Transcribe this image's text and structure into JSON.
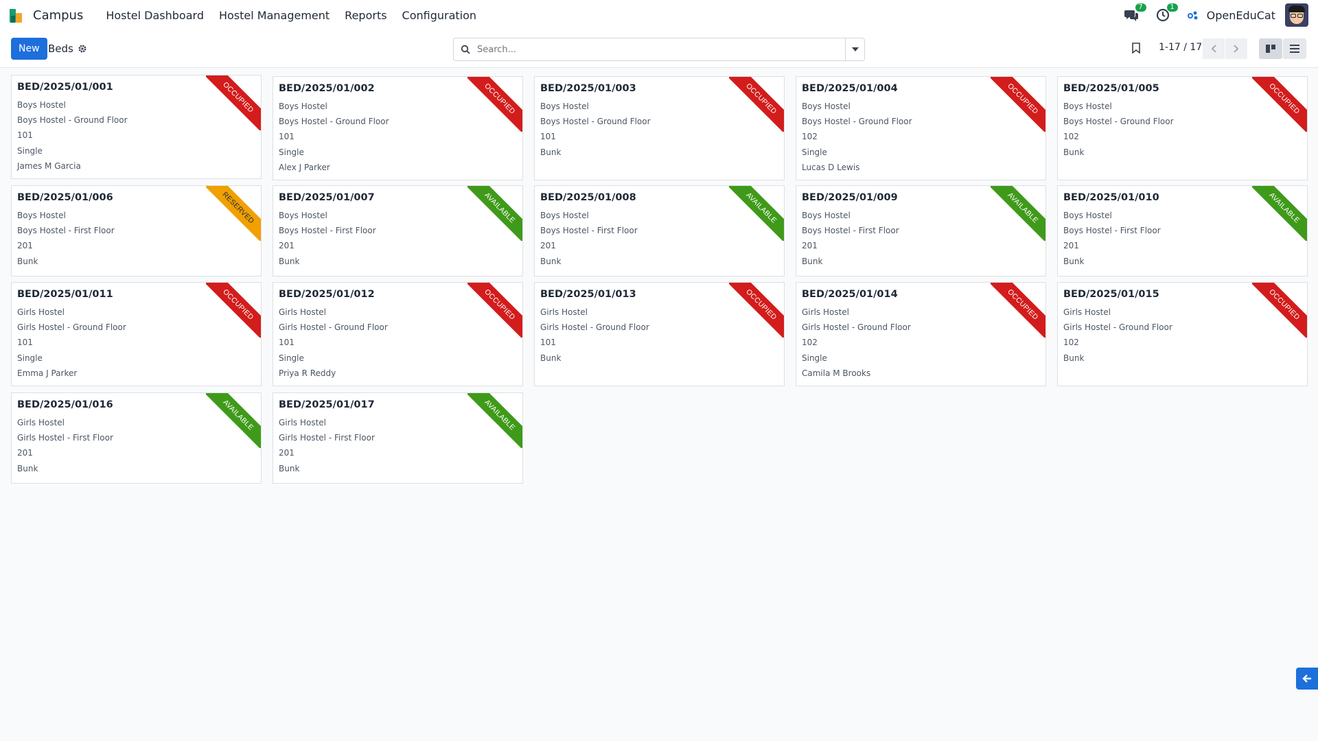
{
  "navbar": {
    "app_name": "Campus",
    "menu": [
      "Hostel Dashboard",
      "Hostel Management",
      "Reports",
      "Configuration"
    ],
    "messages_badge": "7",
    "activities_badge": "1",
    "company": "OpenEduCat"
  },
  "control": {
    "new_label": "New",
    "breadcrumb": "Beds",
    "search_placeholder": "Search...",
    "pager": "1-17 / 17"
  },
  "colors": {
    "primary": "#1d6fdc",
    "occupied": "#d31c1c",
    "available": "#3f9a1a",
    "reserved": "#f0a000"
  },
  "beds": [
    {
      "title": "BED/2025/01/001",
      "hostel": "Boys Hostel",
      "floor": "Boys Hostel - Ground Floor",
      "room": "101",
      "type": "Single",
      "student": "James M Garcia",
      "status": "OCCUPIED"
    },
    {
      "title": "BED/2025/01/002",
      "hostel": "Boys Hostel",
      "floor": "Boys Hostel - Ground Floor",
      "room": "101",
      "type": "Single",
      "student": "Alex J Parker",
      "status": "OCCUPIED"
    },
    {
      "title": "BED/2025/01/003",
      "hostel": "Boys Hostel",
      "floor": "Boys Hostel - Ground Floor",
      "room": "101",
      "type": "Bunk",
      "student": "",
      "status": "OCCUPIED"
    },
    {
      "title": "BED/2025/01/004",
      "hostel": "Boys Hostel",
      "floor": "Boys Hostel - Ground Floor",
      "room": "102",
      "type": "Single",
      "student": "Lucas D Lewis",
      "status": "OCCUPIED"
    },
    {
      "title": "BED/2025/01/005",
      "hostel": "Boys Hostel",
      "floor": "Boys Hostel - Ground Floor",
      "room": "102",
      "type": "Bunk",
      "student": "",
      "status": "OCCUPIED"
    },
    {
      "title": "BED/2025/01/006",
      "hostel": "Boys Hostel",
      "floor": "Boys Hostel - First Floor",
      "room": "201",
      "type": "Bunk",
      "student": "",
      "status": "RESERVED"
    },
    {
      "title": "BED/2025/01/007",
      "hostel": "Boys Hostel",
      "floor": "Boys Hostel - First Floor",
      "room": "201",
      "type": "Bunk",
      "student": "",
      "status": "AVAILABLE"
    },
    {
      "title": "BED/2025/01/008",
      "hostel": "Boys Hostel",
      "floor": "Boys Hostel - First Floor",
      "room": "201",
      "type": "Bunk",
      "student": "",
      "status": "AVAILABLE"
    },
    {
      "title": "BED/2025/01/009",
      "hostel": "Boys Hostel",
      "floor": "Boys Hostel - First Floor",
      "room": "201",
      "type": "Bunk",
      "student": "",
      "status": "AVAILABLE"
    },
    {
      "title": "BED/2025/01/010",
      "hostel": "Boys Hostel",
      "floor": "Boys Hostel - First Floor",
      "room": "201",
      "type": "Bunk",
      "student": "",
      "status": "AVAILABLE"
    },
    {
      "title": "BED/2025/01/011",
      "hostel": "Girls Hostel",
      "floor": "Girls Hostel - Ground Floor",
      "room": "101",
      "type": "Single",
      "student": "Emma J Parker",
      "status": "OCCUPIED"
    },
    {
      "title": "BED/2025/01/012",
      "hostel": "Girls Hostel",
      "floor": "Girls Hostel - Ground Floor",
      "room": "101",
      "type": "Single",
      "student": "Priya R Reddy",
      "status": "OCCUPIED"
    },
    {
      "title": "BED/2025/01/013",
      "hostel": "Girls Hostel",
      "floor": "Girls Hostel - Ground Floor",
      "room": "101",
      "type": "Bunk",
      "student": "",
      "status": "OCCUPIED"
    },
    {
      "title": "BED/2025/01/014",
      "hostel": "Girls Hostel",
      "floor": "Girls Hostel - Ground Floor",
      "room": "102",
      "type": "Single",
      "student": "Camila M Brooks",
      "status": "OCCUPIED"
    },
    {
      "title": "BED/2025/01/015",
      "hostel": "Girls Hostel",
      "floor": "Girls Hostel - Ground Floor",
      "room": "102",
      "type": "Bunk",
      "student": "",
      "status": "OCCUPIED"
    },
    {
      "title": "BED/2025/01/016",
      "hostel": "Girls Hostel",
      "floor": "Girls Hostel - First Floor",
      "room": "201",
      "type": "Bunk",
      "student": "",
      "status": "AVAILABLE"
    },
    {
      "title": "BED/2025/01/017",
      "hostel": "Girls Hostel",
      "floor": "Girls Hostel - First Floor",
      "room": "201",
      "type": "Bunk",
      "student": "",
      "status": "AVAILABLE"
    }
  ]
}
